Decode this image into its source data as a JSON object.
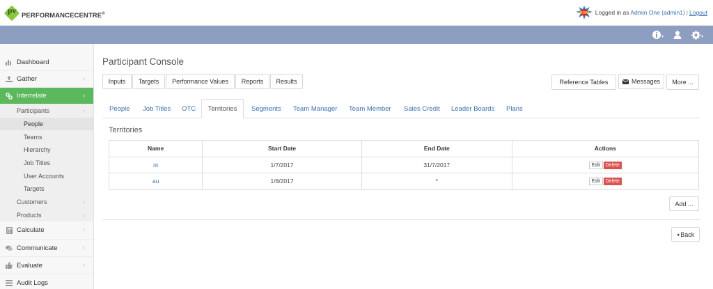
{
  "header": {
    "logo_text": "PERFORMANCECENTRE",
    "logo_mark": "pv",
    "badge_text": "WOW!",
    "login_prefix": "Logged in as ",
    "user_name": "Admin One (admin1)",
    "separator": "|",
    "logout_label": "Logout"
  },
  "navbar": {
    "icons": [
      "info-icon",
      "user-icon",
      "gear-icon"
    ],
    "color": "#8e9ec0"
  },
  "sidebar": {
    "items": [
      {
        "label": "Dashboard",
        "icon": "chart-icon"
      },
      {
        "label": "Gather",
        "icon": "upload-icon"
      },
      {
        "label": "Interrelate",
        "icon": "link-icon"
      },
      {
        "label": "Calculate",
        "icon": "calculator-icon"
      },
      {
        "label": "Communicate",
        "icon": "chat-icon"
      },
      {
        "label": "Evaluate",
        "icon": "thumbs-up-icon"
      },
      {
        "label": "Audit Logs",
        "icon": "list-icon"
      }
    ],
    "sub": {
      "participants": "Participants",
      "people": "People",
      "teams": "Teams",
      "hierarchy": "Hierarchy",
      "job_titles": "Job Titles",
      "user_accounts": "User Accounts",
      "targets": "Targets",
      "customers": "Customers",
      "products": "Products"
    },
    "active_color": "#5cb85c"
  },
  "main": {
    "title": "Participant Console",
    "toolbar": [
      "Inputs",
      "Targets",
      "Performance Values",
      "Reports",
      "Results"
    ],
    "right_buttons": {
      "reference_tables": "Reference Tables",
      "messages": "Messages",
      "more": "More ..."
    },
    "tabs": [
      "People",
      "Job Titles",
      "OTC",
      "Territories",
      "Segments",
      "Team Manager",
      "Team Member",
      "Sales Credit",
      "Leader Boards",
      "Plans"
    ],
    "active_tab": "Territories",
    "section_title": "Territories",
    "table": {
      "headers": [
        "Name",
        "Start Date",
        "End Date",
        "Actions"
      ],
      "rows": [
        {
          "name": "nt",
          "start": "1/7/2017",
          "end": "31/7/2017"
        },
        {
          "name": "au",
          "start": "1/8/2017",
          "end": "*"
        }
      ],
      "edit_label": "Edit",
      "delete_label": "Delete"
    },
    "add_label": "Add ...",
    "back_label": "Back"
  }
}
